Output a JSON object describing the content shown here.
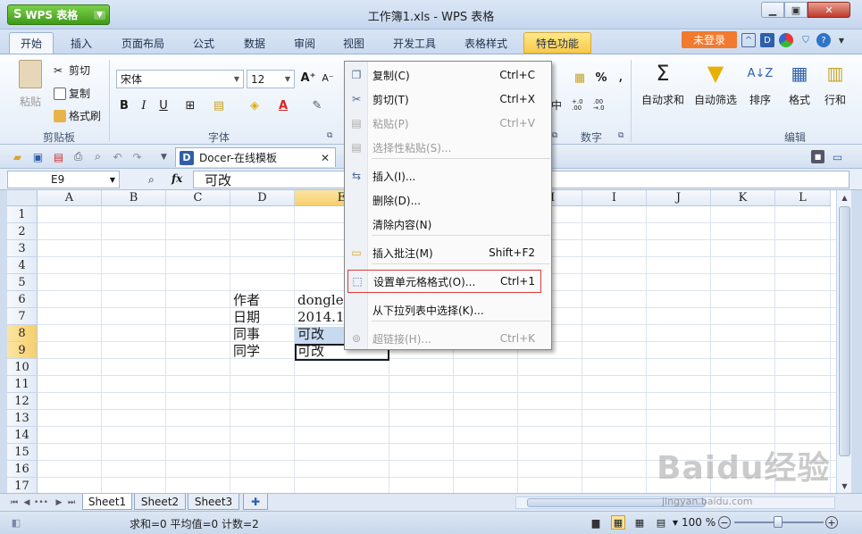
{
  "app": {
    "logo": "WPS 表格",
    "title": "工作簿1.xls - WPS 表格"
  },
  "tabs": [
    "开始",
    "插入",
    "页面布局",
    "公式",
    "数据",
    "审阅",
    "视图",
    "开发工具",
    "表格样式",
    "特色功能"
  ],
  "login_label": "未登录",
  "ribbon": {
    "clipboard": {
      "paste": "粘贴",
      "cut": "剪切",
      "copy": "复制",
      "format_painter": "格式刷",
      "group": "剪贴板"
    },
    "font": {
      "name": "宋体",
      "size": "12",
      "bold": "B",
      "italic": "I",
      "underline": "U",
      "grow": "A⁺",
      "shrink": "A⁻",
      "group": "字体"
    },
    "number": {
      "percent": "%",
      "comma": "⸴",
      "group": "数字",
      "inc": "+.0 .00",
      "dec": ".00 →.0"
    },
    "editing": {
      "autosum": "自动求和",
      "autofilter": "自动筛选",
      "sort": "排序",
      "format": "格式",
      "rowcol": "行和",
      "group": "编辑"
    },
    "partial": "中"
  },
  "doc_tab": {
    "label": "Docer-在线模板"
  },
  "formula_bar": {
    "name_box": "E9",
    "fx": "fx",
    "value": "可改"
  },
  "grid": {
    "columns": [
      "A",
      "B",
      "C",
      "D",
      "E",
      "F",
      "G",
      "H",
      "I",
      "J",
      "K",
      "L"
    ],
    "rows": [
      "1",
      "2",
      "3",
      "4",
      "5",
      "6",
      "7",
      "8",
      "9",
      "10",
      "11",
      "12",
      "13",
      "14",
      "15",
      "16",
      "17"
    ],
    "cells": {
      "D6": "作者",
      "E6": "donglee",
      "D7": "日期",
      "E7": "2014.10",
      "D8": "同事",
      "E8": "可改",
      "D9": "同学",
      "E9": "可改"
    }
  },
  "context_menu": [
    {
      "label": "复制(C)",
      "shortcut": "Ctrl+C",
      "disabled": false
    },
    {
      "label": "剪切(T)",
      "shortcut": "Ctrl+X",
      "disabled": false
    },
    {
      "label": "粘贴(P)",
      "shortcut": "Ctrl+V",
      "disabled": true
    },
    {
      "label": "选择性粘贴(S)...",
      "shortcut": "",
      "disabled": true
    },
    {
      "label": "插入(I)...",
      "shortcut": "",
      "disabled": false
    },
    {
      "label": "删除(D)...",
      "shortcut": "",
      "disabled": false
    },
    {
      "label": "清除内容(N)",
      "shortcut": "",
      "disabled": false
    },
    {
      "label": "插入批注(M)",
      "shortcut": "Shift+F2",
      "disabled": false
    },
    {
      "label": "设置单元格格式(O)...",
      "shortcut": "Ctrl+1",
      "disabled": false
    },
    {
      "label": "从下拉列表中选择(K)...",
      "shortcut": "",
      "disabled": false
    },
    {
      "label": "超链接(H)...",
      "shortcut": "Ctrl+K",
      "disabled": true
    }
  ],
  "sheets": [
    "Sheet1",
    "Sheet2",
    "Sheet3"
  ],
  "add_sheet": "✚",
  "status": {
    "text": "求和=0  平均值=0  计数=2",
    "zoom": "100 %"
  },
  "watermark": {
    "text": "Baidu经验",
    "url": "jingyan.baidu.com"
  },
  "colors": {
    "accent": "#f27a2e",
    "selection": "#c8daf2",
    "highlight_box": "#d93b3b"
  }
}
